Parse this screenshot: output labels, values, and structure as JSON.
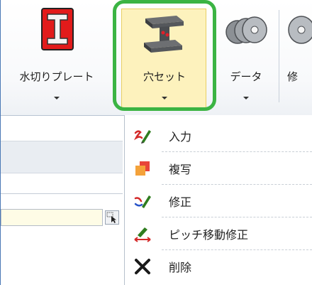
{
  "ribbon": {
    "buttons": [
      {
        "id": "water-cut-plate",
        "label": "水切りプレート",
        "icon": "red-h-beam-icon"
      },
      {
        "id": "hole-set",
        "label": "穴セット",
        "icon": "steel-h-beam-icon",
        "highlight": "#3bb443"
      },
      {
        "id": "data",
        "label": "データ",
        "icon": "disc-stack-icon"
      },
      {
        "id": "modify",
        "label": "修",
        "icon": "disc-icon"
      }
    ]
  },
  "menu": {
    "items": [
      {
        "label": "入力",
        "icon": "pen-input-icon"
      },
      {
        "label": "複写",
        "icon": "copy-icon"
      },
      {
        "label": "修正",
        "icon": "pen-modify-icon"
      },
      {
        "label": "ピッチ移動修正",
        "icon": "pitch-move-icon"
      },
      {
        "label": "削除",
        "icon": "delete-x-icon"
      }
    ]
  }
}
